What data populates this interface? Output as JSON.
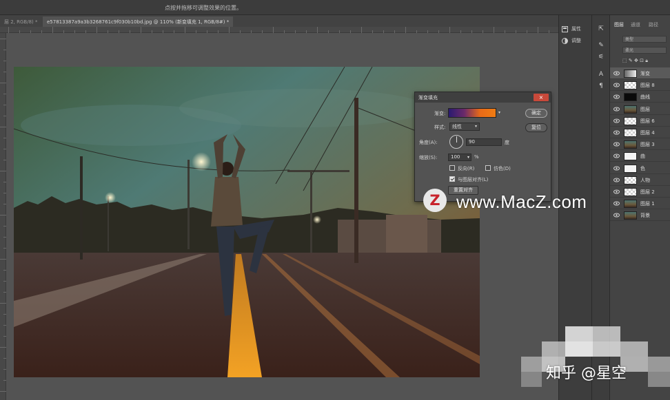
{
  "window": {
    "title": "点按并拖移可调整效果的位置。"
  },
  "tabs": [
    {
      "label": "层 2, RGB/8) *"
    },
    {
      "label": "e57813387a9a3b3268761c9f030b10bd.jpg @ 110% (新变填充 1, RGB/8#) *"
    }
  ],
  "dock": {
    "items": [
      {
        "label": "属性",
        "icon": "properties-icon"
      },
      {
        "label": "调整",
        "icon": "adjustments-icon"
      }
    ]
  },
  "layers_panel": {
    "tabs": [
      "图层",
      "通道",
      "路径"
    ],
    "filter_kind": "类型",
    "blend_mode": "柔光",
    "layers": [
      {
        "name": "渐变",
        "thumb": "gradient",
        "selected": true
      },
      {
        "name": "图层 8",
        "thumb": "checker"
      },
      {
        "name": "曲线",
        "thumb": "black"
      },
      {
        "name": "图层",
        "thumb": "photo"
      },
      {
        "name": "图层 6",
        "thumb": "checker"
      },
      {
        "name": "图层 4",
        "thumb": "checker"
      },
      {
        "name": "图层 3",
        "thumb": "photo"
      },
      {
        "name": "曲",
        "thumb": "white"
      },
      {
        "name": "色",
        "thumb": "white"
      },
      {
        "name": "人物",
        "thumb": "checker"
      },
      {
        "name": "图层 2",
        "thumb": "checker"
      },
      {
        "name": "图层 1",
        "thumb": "photo"
      },
      {
        "name": "背景",
        "thumb": "photo"
      }
    ]
  },
  "dialog": {
    "title": "渐变填充",
    "gradient_label": "渐变:",
    "style_label": "样式:",
    "style_value": "线性",
    "angle_label": "角度(A):",
    "angle_value": "90",
    "angle_unit": "度",
    "scale_label": "缩放(S):",
    "scale_value": "100",
    "scale_unit": "%",
    "reverse_label": "反向(R)",
    "dither_label": "仿色(D)",
    "align_label": "与图层对齐(L)",
    "reset_align_label": "重置对齐",
    "ok_label": "确定",
    "reset_label": "复位",
    "align_checked": true
  },
  "watermarks": {
    "site_logo": "Z",
    "site_text": "www.MacZ.com",
    "zhihu_text": "知乎 @星空"
  }
}
